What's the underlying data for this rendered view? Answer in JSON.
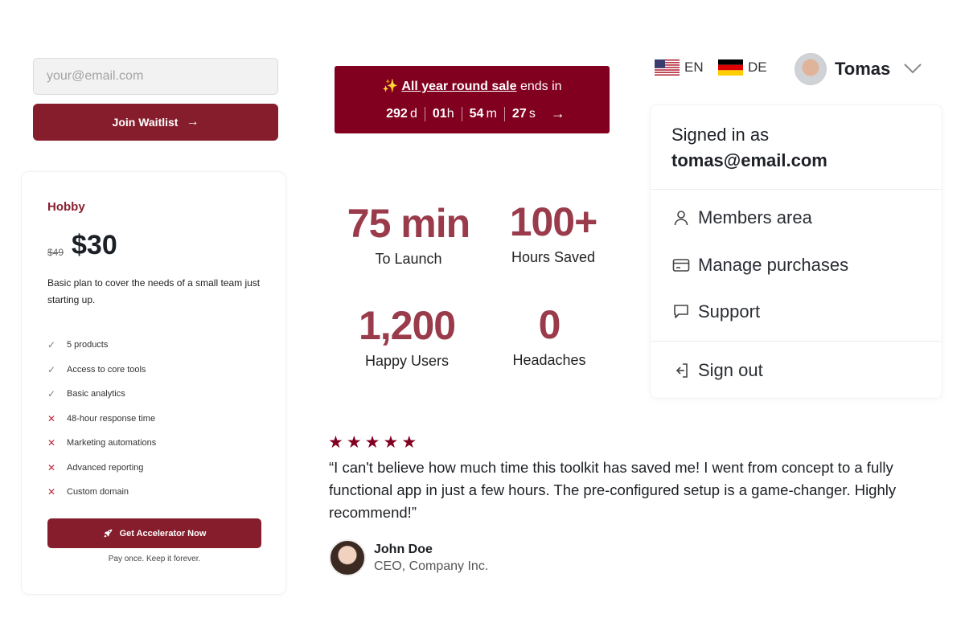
{
  "colors": {
    "brand": "#861d2d",
    "banner_bg": "#82001f",
    "stat_value": "#9a3b4b",
    "check": "#7c7f84",
    "cross": "#c0263a",
    "sparkle": "#f5c84c"
  },
  "waitlist": {
    "email_placeholder": "your@email.com",
    "join_label": "Join Waitlist",
    "join_icon": "arrow-right-icon",
    "join_arrow": "→"
  },
  "pricing": {
    "plan_name": "Hobby",
    "old_price": "$49",
    "price": "$30",
    "description": "Basic plan to cover the needs of a small team just starting up.",
    "features": [
      {
        "label": "5 products",
        "included": true,
        "icon": "check-icon",
        "glyph": "✓"
      },
      {
        "label": "Access to core tools",
        "included": true,
        "icon": "check-icon",
        "glyph": "✓"
      },
      {
        "label": "Basic analytics",
        "included": true,
        "icon": "check-icon",
        "glyph": "✓"
      },
      {
        "label": "48-hour response time",
        "included": false,
        "icon": "cross-icon",
        "glyph": "✕"
      },
      {
        "label": "Marketing automations",
        "included": false,
        "icon": "cross-icon",
        "glyph": "✕"
      },
      {
        "label": "Advanced reporting",
        "included": false,
        "icon": "cross-icon",
        "glyph": "✕"
      },
      {
        "label": "Custom domain",
        "included": false,
        "icon": "cross-icon",
        "glyph": "✕"
      }
    ],
    "cta_label": "Get Accelerator Now",
    "cta_icon": "rocket-icon",
    "note": "Pay once. Keep it forever."
  },
  "sale_banner": {
    "sparkle": "✨",
    "link_text": "All year round sale",
    "suffix": " ends in",
    "countdown": [
      {
        "value": "292",
        "unit": "d"
      },
      {
        "value": "01",
        "unit": "h"
      },
      {
        "value": "54",
        "unit": "m"
      },
      {
        "value": "27",
        "unit": "s"
      }
    ],
    "arrow": "→"
  },
  "stats": [
    {
      "value": "75 min",
      "label": "To Launch"
    },
    {
      "value": "100+",
      "label": "Hours Saved"
    },
    {
      "value": "1,200",
      "label": "Happy Users"
    },
    {
      "value": "0",
      "label": "Headaches"
    }
  ],
  "testimonial": {
    "rating": 5,
    "star_glyph": "★",
    "quote": "“I can't believe how much time this toolkit has saved me! I went from concept to a fully functional app in just a few hours. The pre-configured setup is a game-changer. Highly recommend!”",
    "author_name": "John Doe",
    "author_title": "CEO, Company Inc."
  },
  "languages": [
    {
      "code": "EN",
      "flag": "us-flag-icon"
    },
    {
      "code": "DE",
      "flag": "de-flag-icon"
    }
  ],
  "user": {
    "name": "Tomas",
    "signed_in_label": "Signed in as",
    "email": "tomas@email.com",
    "menu": [
      {
        "label": "Members area",
        "icon": "user-icon"
      },
      {
        "label": "Manage purchases",
        "icon": "credit-card-icon"
      },
      {
        "label": "Support",
        "icon": "chat-bubble-icon"
      },
      {
        "label": "Sign out",
        "icon": "sign-out-icon"
      }
    ]
  }
}
